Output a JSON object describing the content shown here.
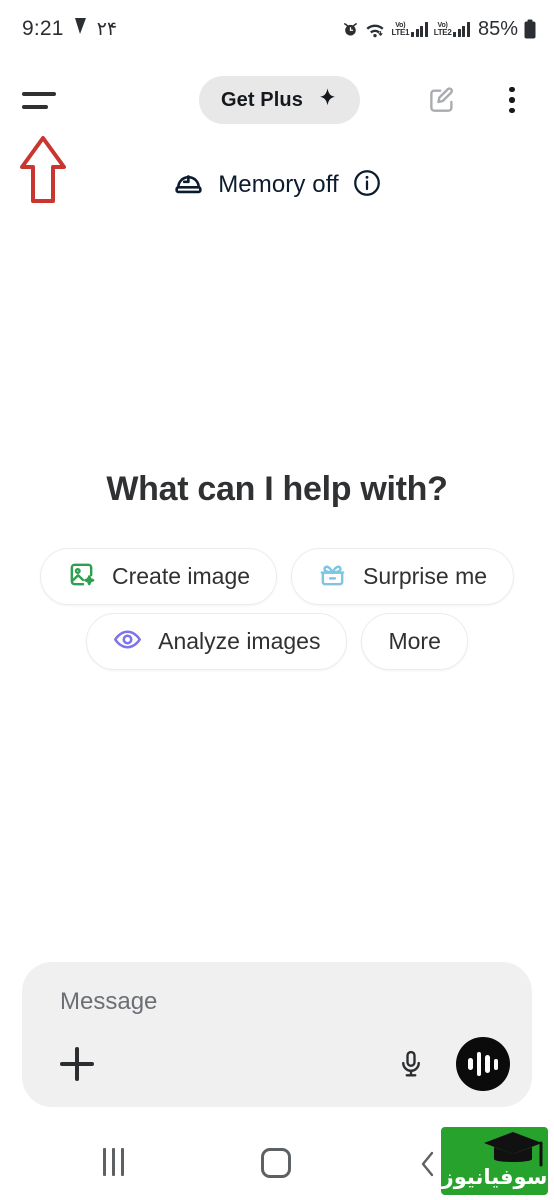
{
  "status_bar": {
    "time": "9:21",
    "nav_glyph": "➤",
    "extra_numerals": "۲۴",
    "alarm_icon": "alarm-clock-icon",
    "wifi_icon": "wifi-icon",
    "sim1_label_top": "Vo)",
    "sim1_label_bottom": "LTE1",
    "sim2_label_top": "Vo)",
    "sim2_label_bottom": "LTE2",
    "battery_percent": "85%",
    "battery_icon": "battery-icon"
  },
  "app_bar": {
    "menu_icon": "hamburger-menu-icon",
    "get_plus_label": "Get Plus",
    "get_plus_sparkle": "sparkle-icon",
    "compose_icon": "compose-new-chat-icon",
    "overflow_icon": "three-dot-menu-icon"
  },
  "annotation": {
    "arrow_color": "#c9352f",
    "arrow_points_to": "hamburger-menu-icon"
  },
  "memory": {
    "icon": "memory-dome-clock-icon",
    "label": "Memory off",
    "info_icon": "info-circle-icon",
    "text_color": "#0d1b2e"
  },
  "main": {
    "headline": "What can I help with?",
    "chip_rows": [
      [
        {
          "label": "Create image",
          "icon": "image-sparkle-icon",
          "icon_color": "#2e9e4f",
          "has_icon": true
        },
        {
          "label": "Surprise me",
          "icon": "gift-box-icon",
          "icon_color": "#7ec4e3",
          "has_icon": true
        }
      ],
      [
        {
          "label": "Analyze images",
          "icon": "eye-icon",
          "icon_color": "#7c74e8",
          "has_icon": true
        },
        {
          "label": "More",
          "icon": "",
          "icon_color": "",
          "has_icon": false
        }
      ]
    ]
  },
  "composer": {
    "placeholder": "Message",
    "value": "",
    "attach_icon": "plus-icon",
    "mic_icon": "microphone-icon",
    "voice_icon": "voice-waveform-icon",
    "voice_button_color": "#0b0b0b"
  },
  "nav_bar": {
    "recents_icon": "recents-icon",
    "home_icon": "home-icon",
    "back_icon": "back-icon"
  },
  "watermark": {
    "text": "سوفیانیوز",
    "cap_icon": "graduation-cap-icon",
    "background_color": "#27a32d"
  }
}
